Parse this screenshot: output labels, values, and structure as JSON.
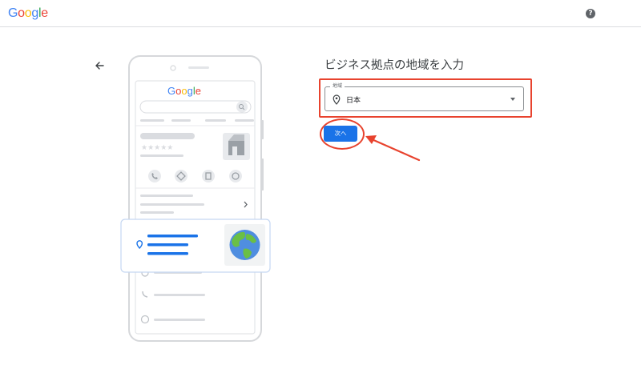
{
  "header": {
    "logo_letters": [
      {
        "ch": "G",
        "color": "#4285f4"
      },
      {
        "ch": "o",
        "color": "#ea4335"
      },
      {
        "ch": "o",
        "color": "#fbbc05"
      },
      {
        "ch": "g",
        "color": "#4285f4"
      },
      {
        "ch": "l",
        "color": "#34a853"
      },
      {
        "ch": "e",
        "color": "#ea4335"
      }
    ],
    "help_glyph": "?"
  },
  "illustration": {
    "phone_logo_letters": [
      {
        "ch": "G",
        "color": "#4285f4"
      },
      {
        "ch": "o",
        "color": "#ea4335"
      },
      {
        "ch": "o",
        "color": "#fbbc05"
      },
      {
        "ch": "g",
        "color": "#4285f4"
      },
      {
        "ch": "l",
        "color": "#34a853"
      },
      {
        "ch": "e",
        "color": "#ea4335"
      }
    ],
    "rating_stars": "★★★★★",
    "icons": [
      "phone-icon",
      "directions-icon",
      "save-icon",
      "website-icon",
      "map-pin-icon",
      "globe-icon",
      "clock-icon",
      "call-icon"
    ]
  },
  "main": {
    "title": "ビジネス拠点の地域を入力",
    "region_field": {
      "label": "地域",
      "value": "日本"
    },
    "next_label": "次へ"
  },
  "colors": {
    "accent": "#1a73e8",
    "annotation": "#e8432e"
  }
}
